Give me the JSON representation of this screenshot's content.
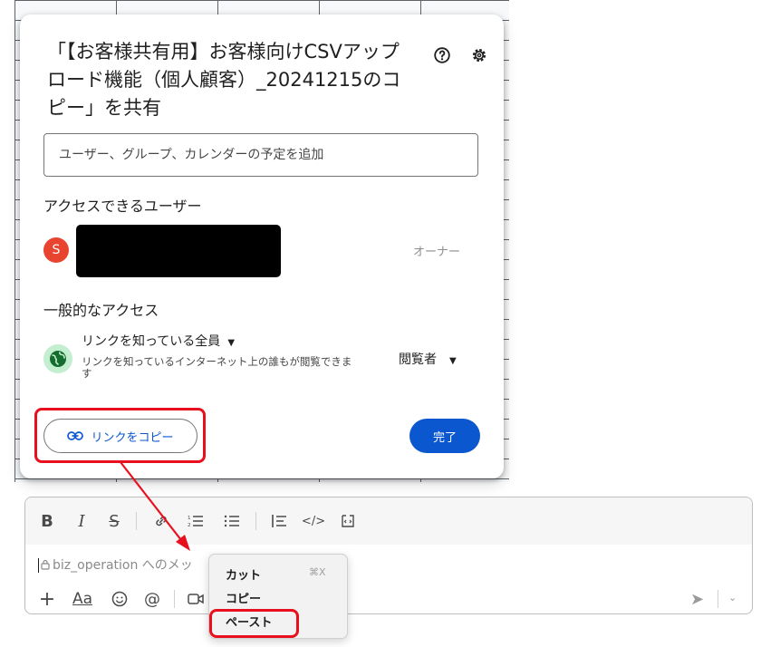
{
  "dialog": {
    "title": "「【お客様共有用】お客様向けCSVアップロード機能（個人顧客）_20241215のコピー」を共有",
    "add_people_placeholder": "ユーザー、グループ、カレンダーの予定を追加",
    "access_users_heading": "アクセスできるユーザー",
    "user_avatar_initial": "S",
    "user_role": "オーナー",
    "general_access_heading": "一般的なアクセス",
    "link_scope": "リンクを知っている全員",
    "link_description": "リンクを知っているインターネット上の誰もが閲覧できます",
    "link_role": "閲覧者",
    "copy_link_label": "リンクをコピー",
    "done_label": "完了",
    "icons": [
      "help-icon",
      "gear-icon",
      "globe-icon",
      "link-icon",
      "dropdown-caret-icon"
    ]
  },
  "composer": {
    "placeholder": "biz_operation へのメッ",
    "toolbar_icons": [
      "bold-icon",
      "italic-icon",
      "strikethrough-icon",
      "link-icon",
      "ordered-list-icon",
      "bulleted-list-icon",
      "blockquote-icon",
      "code-icon",
      "code-block-icon"
    ],
    "bottom_icons": [
      "plus-icon",
      "format-text-icon",
      "emoji-icon",
      "mention-icon",
      "video-icon",
      "send-icon",
      "send-options-icon"
    ],
    "format_label": "Aa"
  },
  "context_menu": {
    "items": [
      {
        "label": "カット",
        "shortcut": "⌘X"
      },
      {
        "label": "コピー",
        "shortcut": ""
      },
      {
        "label": "ペースト",
        "shortcut": ""
      }
    ]
  },
  "colors": {
    "annotation_red": "#e8101f",
    "primary_blue": "#0b57d0",
    "avatar_red": "#e8442f",
    "globe_bg": "#c4eed0"
  }
}
